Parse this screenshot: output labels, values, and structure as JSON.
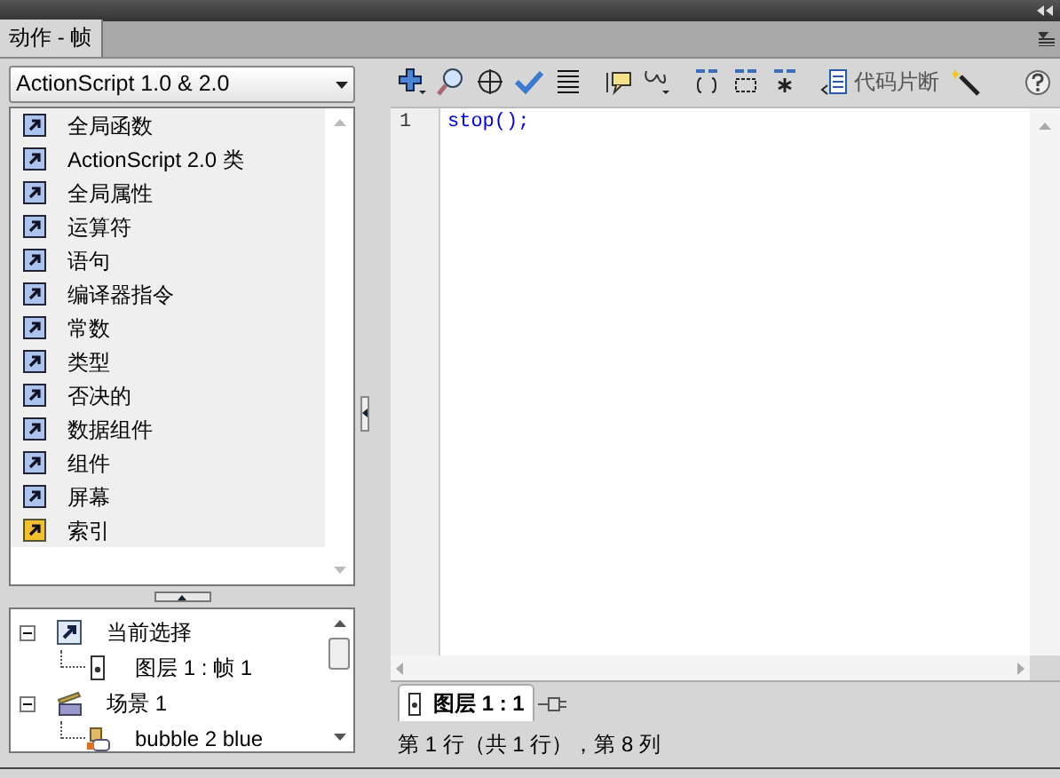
{
  "panel_tab": {
    "label": "动作 - 帧"
  },
  "language_dropdown": {
    "value": "ActionScript 1.0 & 2.0"
  },
  "action_categories": [
    {
      "label": "全局函数",
      "kind": "book"
    },
    {
      "label": "ActionScript 2.0 类",
      "kind": "book"
    },
    {
      "label": "全局属性",
      "kind": "book"
    },
    {
      "label": "运算符",
      "kind": "book"
    },
    {
      "label": "语句",
      "kind": "book"
    },
    {
      "label": "编译器指令",
      "kind": "book"
    },
    {
      "label": "常数",
      "kind": "book"
    },
    {
      "label": "类型",
      "kind": "book"
    },
    {
      "label": "否决的",
      "kind": "book"
    },
    {
      "label": "数据组件",
      "kind": "book"
    },
    {
      "label": "组件",
      "kind": "book"
    },
    {
      "label": "屏幕",
      "kind": "book"
    },
    {
      "label": "索引",
      "kind": "index"
    }
  ],
  "script_tree": [
    {
      "label": "当前选择",
      "kind": "selection",
      "expanded": true,
      "children": [
        {
          "label": "图层 1 : 帧 1",
          "kind": "frame"
        }
      ]
    },
    {
      "label": "场景 1",
      "kind": "scene",
      "expanded": true,
      "children": [
        {
          "label": "bubble 2 blue",
          "kind": "symbol"
        }
      ]
    }
  ],
  "toolbar": {
    "snippets_label": "代码片断"
  },
  "editor": {
    "lines": [
      {
        "number": "1",
        "code": "stop();"
      }
    ]
  },
  "script_tabs": [
    {
      "label": "图层 1 : 1",
      "selected": true
    }
  ],
  "status_bar": "第 1 行（共 1 行），第 8 列"
}
